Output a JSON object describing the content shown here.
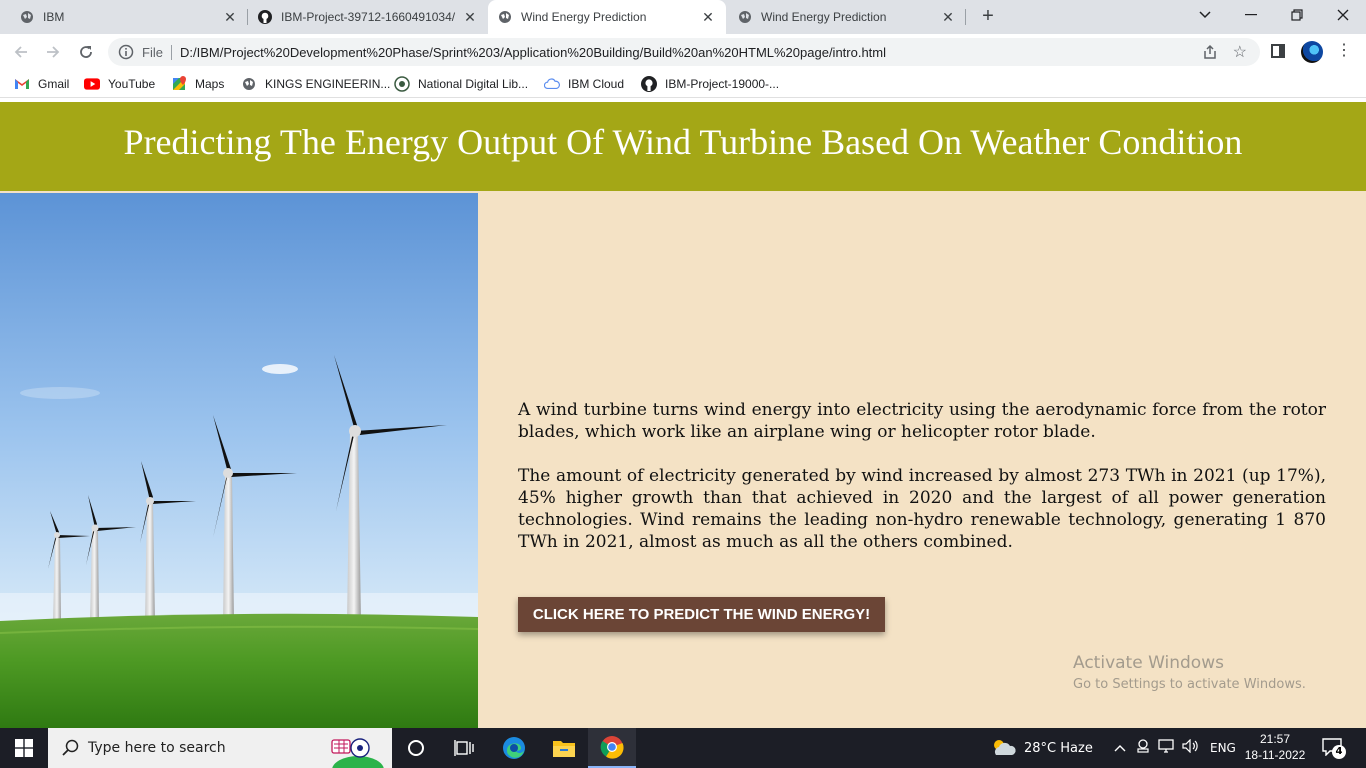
{
  "browser": {
    "tabs": [
      {
        "title": "IBM",
        "active": false
      },
      {
        "title": "IBM-Project-39712-1660491034/",
        "active": false
      },
      {
        "title": "Wind Energy Prediction",
        "active": true
      },
      {
        "title": "Wind Energy Prediction",
        "active": false
      }
    ],
    "new_tab": "+",
    "address": {
      "scheme_label": "File",
      "url": "D:/IBM/Project%20Development%20Phase/Sprint%203/Application%20Building/Build%20an%20HTML%20page/intro.html"
    },
    "bookmarks": [
      {
        "label": "Gmail",
        "icon": "gmail-icon"
      },
      {
        "label": "YouTube",
        "icon": "youtube-icon"
      },
      {
        "label": "Maps",
        "icon": "maps-icon"
      },
      {
        "label": "KINGS ENGINEERIN...",
        "icon": "globe-icon"
      },
      {
        "label": "National Digital Lib...",
        "icon": "ndl-icon"
      },
      {
        "label": "IBM Cloud",
        "icon": "cloud-icon"
      },
      {
        "label": "IBM-Project-19000-...",
        "icon": "github-icon"
      }
    ]
  },
  "page": {
    "heading": "Predicting The Energy Output Of Wind Turbine Based On Weather Condition",
    "paragraphs": [
      "A wind turbine turns wind energy into electricity using the aerodynamic force from the rotor blades, which work like an airplane wing or helicopter rotor blade.",
      "The amount of electricity generated by wind increased by almost 273 TWh in 2021 (up 17%), 45% higher growth than that achieved in 2020 and the largest of all power generation technologies. Wind remains the leading non-hydro renewable technology, generating 1 870 TWh in 2021, almost as much as all the others combined."
    ],
    "cta_label": "CLICK HERE TO PREDICT THE WIND ENERGY!",
    "colors": {
      "banner": "#a4a716",
      "background": "#f4e2c5",
      "button": "#6b4536"
    }
  },
  "watermark": {
    "line1": "Activate Windows",
    "line2": "Go to Settings to activate Windows."
  },
  "taskbar": {
    "search_placeholder": "Type here to search",
    "weather": "28°C  Haze",
    "language": "ENG",
    "time": "21:57",
    "date": "18-11-2022",
    "notification_count": "4"
  }
}
